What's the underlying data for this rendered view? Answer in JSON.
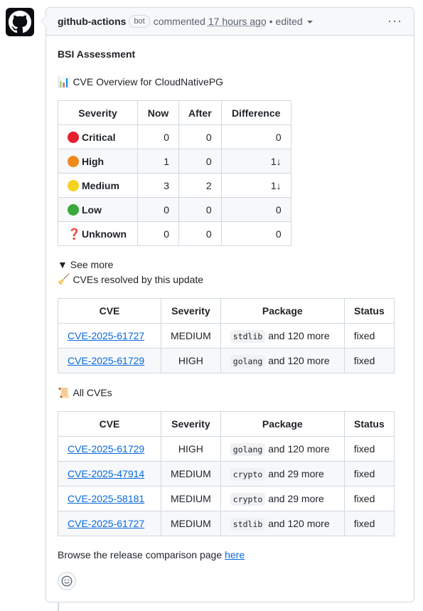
{
  "header": {
    "author": "github-actions",
    "badge": "bot",
    "action": "commented",
    "timestamp": "17 hours ago",
    "separator": "•",
    "edited": "edited",
    "menu": "···"
  },
  "body": {
    "heading": "BSI Assessment",
    "overview_icon": "📊",
    "overview_title": "CVE Overview for CloudNativePG",
    "overview_table": {
      "headers": [
        "Severity",
        "Now",
        "After",
        "Difference"
      ],
      "rows": [
        {
          "severity": "Critical",
          "color": "#e5202e",
          "now": "0",
          "after": "0",
          "diff": "0"
        },
        {
          "severity": "High",
          "color": "#f0891c",
          "now": "1",
          "after": "0",
          "diff": "1↓"
        },
        {
          "severity": "Medium",
          "color": "#f7d21e",
          "now": "3",
          "after": "2",
          "diff": "1↓"
        },
        {
          "severity": "Low",
          "color": "#3aa83a",
          "now": "0",
          "after": "0",
          "diff": "0"
        },
        {
          "severity": "Unknown",
          "icon": "❓",
          "now": "0",
          "after": "0",
          "diff": "0"
        }
      ]
    },
    "see_more": "▼ See more",
    "resolved_icon": "🧹",
    "resolved_title": "CVEs resolved by this update",
    "resolved_table": {
      "headers": [
        "CVE",
        "Severity",
        "Package",
        "Status"
      ],
      "rows": [
        {
          "cve": "CVE-2025-61727",
          "severity": "MEDIUM",
          "pkg": "stdlib",
          "more": "and 120 more",
          "status": "fixed"
        },
        {
          "cve": "CVE-2025-61729",
          "severity": "HIGH",
          "pkg": "golang",
          "more": "and 120 more",
          "status": "fixed"
        }
      ]
    },
    "all_icon": "📜",
    "all_title": "All CVEs",
    "all_table": {
      "headers": [
        "CVE",
        "Severity",
        "Package",
        "Status"
      ],
      "rows": [
        {
          "cve": "CVE-2025-61729",
          "severity": "HIGH",
          "pkg": "golang",
          "more": "and 120 more",
          "status": "fixed"
        },
        {
          "cve": "CVE-2025-47914",
          "severity": "MEDIUM",
          "pkg": "crypto",
          "more": "and 29 more",
          "status": "fixed"
        },
        {
          "cve": "CVE-2025-58181",
          "severity": "MEDIUM",
          "pkg": "crypto",
          "more": "and 29 more",
          "status": "fixed"
        },
        {
          "cve": "CVE-2025-61727",
          "severity": "MEDIUM",
          "pkg": "stdlib",
          "more": "and 120 more",
          "status": "fixed"
        }
      ]
    },
    "footer_text": "Browse the release comparison page",
    "footer_link": "here"
  },
  "icons": {
    "avatar": "github-logo-icon",
    "reaction": "smiley-icon"
  }
}
